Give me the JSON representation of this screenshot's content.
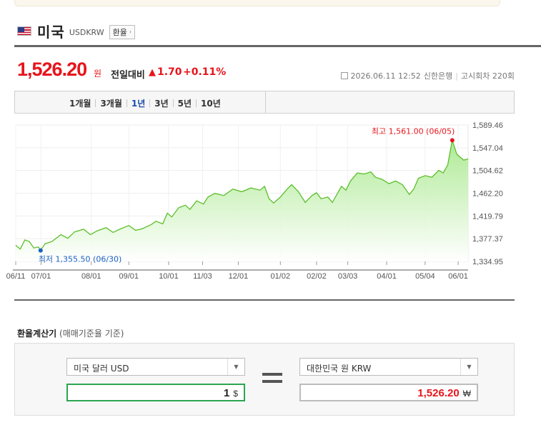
{
  "header": {
    "country": "미국",
    "code": "USDKRW",
    "exchange_button": "환율"
  },
  "quote": {
    "price": "1,526.20",
    "unit": "원",
    "compare_label": "전일대비",
    "change_arrow": "▲",
    "change": "1.70",
    "change_pct": "+0.11%",
    "datetime": "2026.06.11 12:52",
    "bank": "신한은행",
    "notice_round": "고시회차 220회"
  },
  "tabs": [
    {
      "label": "1개월",
      "active": false
    },
    {
      "label": "3개월",
      "active": false
    },
    {
      "label": "1년",
      "active": true
    },
    {
      "label": "3년",
      "active": false
    },
    {
      "label": "5년",
      "active": false
    },
    {
      "label": "10년",
      "active": false
    }
  ],
  "chart_data": {
    "type": "area",
    "y_ticks": [
      "1,589.46",
      "1,547.04",
      "1,504.62",
      "1,462.20",
      "1,419.79",
      "1,377.37",
      "1,334.95"
    ],
    "ylim": [
      1334.95,
      1589.46
    ],
    "x_ticks": [
      "06/11",
      "07/01",
      "08/01",
      "09/01",
      "10/01",
      "11/03",
      "12/01",
      "01/02",
      "02/02",
      "03/03",
      "04/01",
      "05/04",
      "06/01"
    ],
    "max_label": "최고 1,561.00 (06/05)",
    "min_label": "최저 1,355.50 (06/30)",
    "max": {
      "x": 0.965,
      "value": 1561.0
    },
    "min": {
      "x": 0.055,
      "value": 1355.5
    },
    "series": [
      {
        "values": [
          [
            0.0,
            1365
          ],
          [
            0.01,
            1358
          ],
          [
            0.02,
            1375
          ],
          [
            0.03,
            1372
          ],
          [
            0.04,
            1360
          ],
          [
            0.05,
            1362
          ],
          [
            0.055,
            1355.5
          ],
          [
            0.065,
            1368
          ],
          [
            0.08,
            1372
          ],
          [
            0.1,
            1385
          ],
          [
            0.115,
            1378
          ],
          [
            0.13,
            1390
          ],
          [
            0.15,
            1395
          ],
          [
            0.165,
            1385
          ],
          [
            0.18,
            1392
          ],
          [
            0.2,
            1398
          ],
          [
            0.215,
            1389
          ],
          [
            0.23,
            1395
          ],
          [
            0.25,
            1402
          ],
          [
            0.265,
            1393
          ],
          [
            0.28,
            1396
          ],
          [
            0.3,
            1404
          ],
          [
            0.31,
            1410
          ],
          [
            0.325,
            1405
          ],
          [
            0.335,
            1425
          ],
          [
            0.345,
            1418
          ],
          [
            0.36,
            1435
          ],
          [
            0.375,
            1440
          ],
          [
            0.385,
            1432
          ],
          [
            0.4,
            1448
          ],
          [
            0.415,
            1442
          ],
          [
            0.425,
            1455
          ],
          [
            0.44,
            1462
          ],
          [
            0.46,
            1458
          ],
          [
            0.48,
            1470
          ],
          [
            0.5,
            1465
          ],
          [
            0.52,
            1472
          ],
          [
            0.54,
            1468
          ],
          [
            0.55,
            1475
          ],
          [
            0.56,
            1452
          ],
          [
            0.57,
            1444
          ],
          [
            0.585,
            1455
          ],
          [
            0.6,
            1470
          ],
          [
            0.61,
            1478
          ],
          [
            0.625,
            1465
          ],
          [
            0.64,
            1445
          ],
          [
            0.655,
            1458
          ],
          [
            0.665,
            1463
          ],
          [
            0.675,
            1452
          ],
          [
            0.69,
            1455
          ],
          [
            0.7,
            1445
          ],
          [
            0.71,
            1460
          ],
          [
            0.72,
            1475
          ],
          [
            0.73,
            1468
          ],
          [
            0.74,
            1485
          ],
          [
            0.755,
            1500
          ],
          [
            0.77,
            1498
          ],
          [
            0.785,
            1502
          ],
          [
            0.795,
            1492
          ],
          [
            0.81,
            1488
          ],
          [
            0.825,
            1480
          ],
          [
            0.84,
            1485
          ],
          [
            0.855,
            1478
          ],
          [
            0.87,
            1460
          ],
          [
            0.88,
            1470
          ],
          [
            0.89,
            1490
          ],
          [
            0.905,
            1495
          ],
          [
            0.92,
            1492
          ],
          [
            0.935,
            1505
          ],
          [
            0.945,
            1500
          ],
          [
            0.955,
            1515
          ],
          [
            0.965,
            1561
          ],
          [
            0.975,
            1535
          ],
          [
            0.99,
            1524
          ],
          [
            1.0,
            1526.2
          ]
        ]
      }
    ]
  },
  "calculator": {
    "title": "환율계산기",
    "subtitle": "(매매기준율 기준)",
    "from_currency": "미국 달러 USD",
    "to_currency": "대한민국 원 KRW",
    "from_amount": "1",
    "from_unit": "$",
    "to_amount": "1,526.20",
    "to_unit": "₩"
  }
}
